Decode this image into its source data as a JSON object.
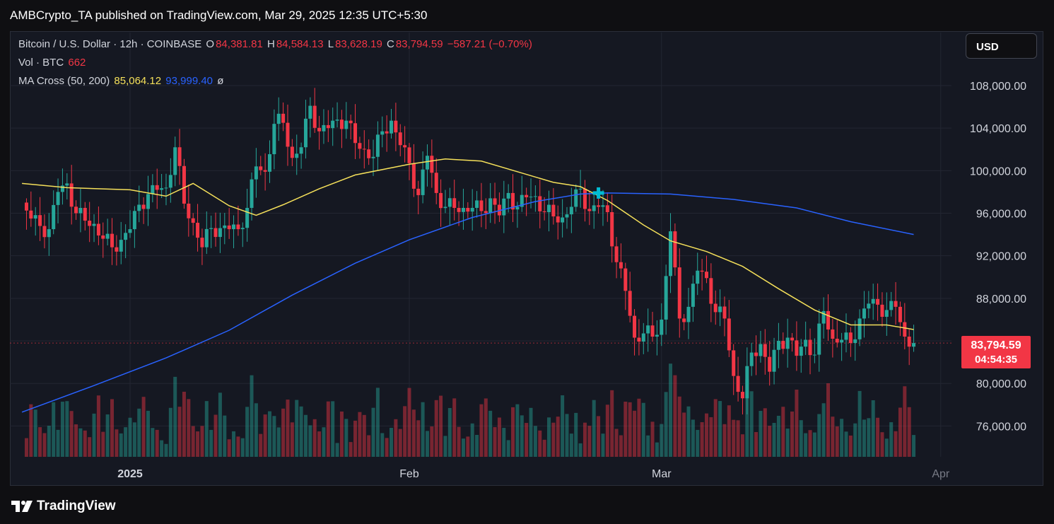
{
  "header": {
    "publisher_line": "AMBCrypto_TA published on TradingView.com, Mar 29, 2025 12:35 UTC+5:30"
  },
  "legend": {
    "symbol": "Bitcoin / U.S. Dollar · 12h · COINBASE",
    "open_key": "O",
    "open": "84,381.81",
    "high_key": "H",
    "high": "84,584.13",
    "low_key": "L",
    "low": "83,628.19",
    "close_key": "C",
    "close": "83,794.59",
    "change": "−587.21 (−0.70%)",
    "volume_label": "Vol · BTC",
    "volume_value": "662",
    "ma_label": "MA Cross (50, 200)",
    "ma50_value": "85,064.12",
    "ma200_value": "93,999.40",
    "ma_extra": "ø"
  },
  "toolbar": {
    "currency_label": "USD"
  },
  "price_tag": {
    "price": "83,794.59",
    "countdown": "04:54:35"
  },
  "footer": {
    "brand": "TradingView"
  },
  "colors": {
    "up": "#26a69a",
    "down": "#f23645",
    "ma50": "#f5e05a",
    "ma200": "#2962ff",
    "cross": "#00bcd4",
    "background": "#151822",
    "grid": "#232632"
  },
  "chart_data": {
    "type": "candlestick",
    "interval": "12h",
    "x_tick_labels": [
      "2025",
      "Feb",
      "Mar",
      "Apr"
    ],
    "x_tick_dates": [
      "2025-01-01",
      "2025-02-01",
      "2025-03-01",
      "2025-04-01"
    ],
    "y_tick_labels": [
      "76,000.00",
      "80,000.00",
      "84,000.00",
      "88,000.00",
      "92,000.00",
      "96,000.00",
      "100,000.00",
      "104,000.00",
      "108,000.00"
    ],
    "y_ticks": [
      76000,
      80000,
      84000,
      88000,
      92000,
      96000,
      100000,
      104000,
      108000
    ],
    "ylim": [
      73000,
      111000
    ],
    "close_path": [
      [
        "2024-12-20",
        97000
      ],
      [
        "2024-12-21",
        95500
      ],
      [
        "2024-12-22",
        94800
      ],
      [
        "2024-12-23",
        94500
      ],
      [
        "2024-12-24",
        98000
      ],
      [
        "2024-12-25",
        98800
      ],
      [
        "2024-12-26",
        96000
      ],
      [
        "2024-12-27",
        95300
      ],
      [
        "2024-12-28",
        95000
      ],
      [
        "2024-12-29",
        93600
      ],
      [
        "2024-12-30",
        92800
      ],
      [
        "2024-12-31",
        93500
      ],
      [
        "2025-01-01",
        94500
      ],
      [
        "2025-01-02",
        96800
      ],
      [
        "2025-01-03",
        97800
      ],
      [
        "2025-01-04",
        98200
      ],
      [
        "2025-01-05",
        98400
      ],
      [
        "2025-01-06",
        102200
      ],
      [
        "2025-01-07",
        96900
      ],
      [
        "2025-01-08",
        95100
      ],
      [
        "2025-01-09",
        92800
      ],
      [
        "2025-01-10",
        94600
      ],
      [
        "2025-01-11",
        94600
      ],
      [
        "2025-01-12",
        94500
      ],
      [
        "2025-01-13",
        94500
      ],
      [
        "2025-01-14",
        96500
      ],
      [
        "2025-01-15",
        100400
      ],
      [
        "2025-01-16",
        99900
      ],
      [
        "2025-01-17",
        104400
      ],
      [
        "2025-01-18",
        104500
      ],
      [
        "2025-01-19",
        101200
      ],
      [
        "2025-01-20",
        102200
      ],
      [
        "2025-01-21",
        106100
      ],
      [
        "2025-01-22",
        103700
      ],
      [
        "2025-01-23",
        104000
      ],
      [
        "2025-01-24",
        104800
      ],
      [
        "2025-01-25",
        104700
      ],
      [
        "2025-01-26",
        102600
      ],
      [
        "2025-01-27",
        102000
      ],
      [
        "2025-01-28",
        101300
      ],
      [
        "2025-01-29",
        103700
      ],
      [
        "2025-01-30",
        104700
      ],
      [
        "2025-01-31",
        102400
      ],
      [
        "2025-02-01",
        100700
      ],
      [
        "2025-02-02",
        97700
      ],
      [
        "2025-02-03",
        101400
      ],
      [
        "2025-02-04",
        97900
      ],
      [
        "2025-02-05",
        96600
      ],
      [
        "2025-02-06",
        96500
      ],
      [
        "2025-02-07",
        96500
      ],
      [
        "2025-02-08",
        96500
      ],
      [
        "2025-02-09",
        96200
      ],
      [
        "2025-02-10",
        97400
      ],
      [
        "2025-02-11",
        95800
      ],
      [
        "2025-02-12",
        97900
      ],
      [
        "2025-02-13",
        96600
      ],
      [
        "2025-02-14",
        97500
      ],
      [
        "2025-02-15",
        97600
      ],
      [
        "2025-02-16",
        96100
      ],
      [
        "2025-02-17",
        95700
      ],
      [
        "2025-02-18",
        95600
      ],
      [
        "2025-02-19",
        96600
      ],
      [
        "2025-02-20",
        98300
      ],
      [
        "2025-02-21",
        96200
      ],
      [
        "2025-02-22",
        96600
      ],
      [
        "2025-02-23",
        96100
      ],
      [
        "2025-02-24",
        91400
      ],
      [
        "2025-02-25",
        88700
      ],
      [
        "2025-02-26",
        84300
      ],
      [
        "2025-02-27",
        84700
      ],
      [
        "2025-02-28",
        84400
      ],
      [
        "2025-03-01",
        86000
      ],
      [
        "2025-03-02",
        94300
      ],
      [
        "2025-03-03",
        86100
      ],
      [
        "2025-03-04",
        87200
      ],
      [
        "2025-03-05",
        90600
      ],
      [
        "2025-03-06",
        89900
      ],
      [
        "2025-03-07",
        86700
      ],
      [
        "2025-03-08",
        86100
      ],
      [
        "2025-03-09",
        80700
      ],
      [
        "2025-03-10",
        78600
      ],
      [
        "2025-03-11",
        82900
      ],
      [
        "2025-03-12",
        83700
      ],
      [
        "2025-03-13",
        81100
      ],
      [
        "2025-03-14",
        84000
      ],
      [
        "2025-03-15",
        84300
      ],
      [
        "2025-03-16",
        82600
      ],
      [
        "2025-03-17",
        84100
      ],
      [
        "2025-03-18",
        82700
      ],
      [
        "2025-03-19",
        86800
      ],
      [
        "2025-03-20",
        84200
      ],
      [
        "2025-03-21",
        84100
      ],
      [
        "2025-03-22",
        83800
      ],
      [
        "2025-03-23",
        86100
      ],
      [
        "2025-03-24",
        87500
      ],
      [
        "2025-03-25",
        87400
      ],
      [
        "2025-03-26",
        86900
      ],
      [
        "2025-03-27",
        87200
      ],
      [
        "2025-03-28",
        84400
      ],
      [
        "2025-03-29",
        83794.59
      ]
    ],
    "ma50_path": [
      [
        "2024-12-20",
        98800
      ],
      [
        "2024-12-25",
        98400
      ],
      [
        "2025-01-01",
        98200
      ],
      [
        "2025-01-05",
        97600
      ],
      [
        "2025-01-08",
        98800
      ],
      [
        "2025-01-12",
        96700
      ],
      [
        "2025-01-15",
        95800
      ],
      [
        "2025-01-18",
        96800
      ],
      [
        "2025-01-22",
        98300
      ],
      [
        "2025-01-26",
        99600
      ],
      [
        "2025-02-01",
        100600
      ],
      [
        "2025-02-05",
        101100
      ],
      [
        "2025-02-09",
        100900
      ],
      [
        "2025-02-13",
        99900
      ],
      [
        "2025-02-17",
        98900
      ],
      [
        "2025-02-20",
        98500
      ],
      [
        "2025-02-23",
        97200
      ],
      [
        "2025-02-27",
        94900
      ],
      [
        "2025-03-02",
        93400
      ],
      [
        "2025-03-06",
        92400
      ],
      [
        "2025-03-10",
        91000
      ],
      [
        "2025-03-14",
        88900
      ],
      [
        "2025-03-18",
        86900
      ],
      [
        "2025-03-22",
        85500
      ],
      [
        "2025-03-26",
        85500
      ],
      [
        "2025-03-29",
        85064.12
      ]
    ],
    "ma200_path": [
      [
        "2024-12-20",
        77300
      ],
      [
        "2024-12-28",
        79800
      ],
      [
        "2025-01-05",
        82400
      ],
      [
        "2025-01-12",
        85000
      ],
      [
        "2025-01-19",
        88300
      ],
      [
        "2025-01-26",
        91300
      ],
      [
        "2025-02-01",
        93500
      ],
      [
        "2025-02-08",
        95600
      ],
      [
        "2025-02-15",
        97100
      ],
      [
        "2025-02-20",
        97800
      ],
      [
        "2025-02-23",
        97900
      ],
      [
        "2025-03-02",
        97800
      ],
      [
        "2025-03-09",
        97300
      ],
      [
        "2025-03-16",
        96500
      ],
      [
        "2025-03-22",
        95200
      ],
      [
        "2025-03-29",
        93999.4
      ]
    ],
    "ma_cross_date": "2025-02-22",
    "ma_cross_value": 97900,
    "volume_max_btc": 40000
  }
}
